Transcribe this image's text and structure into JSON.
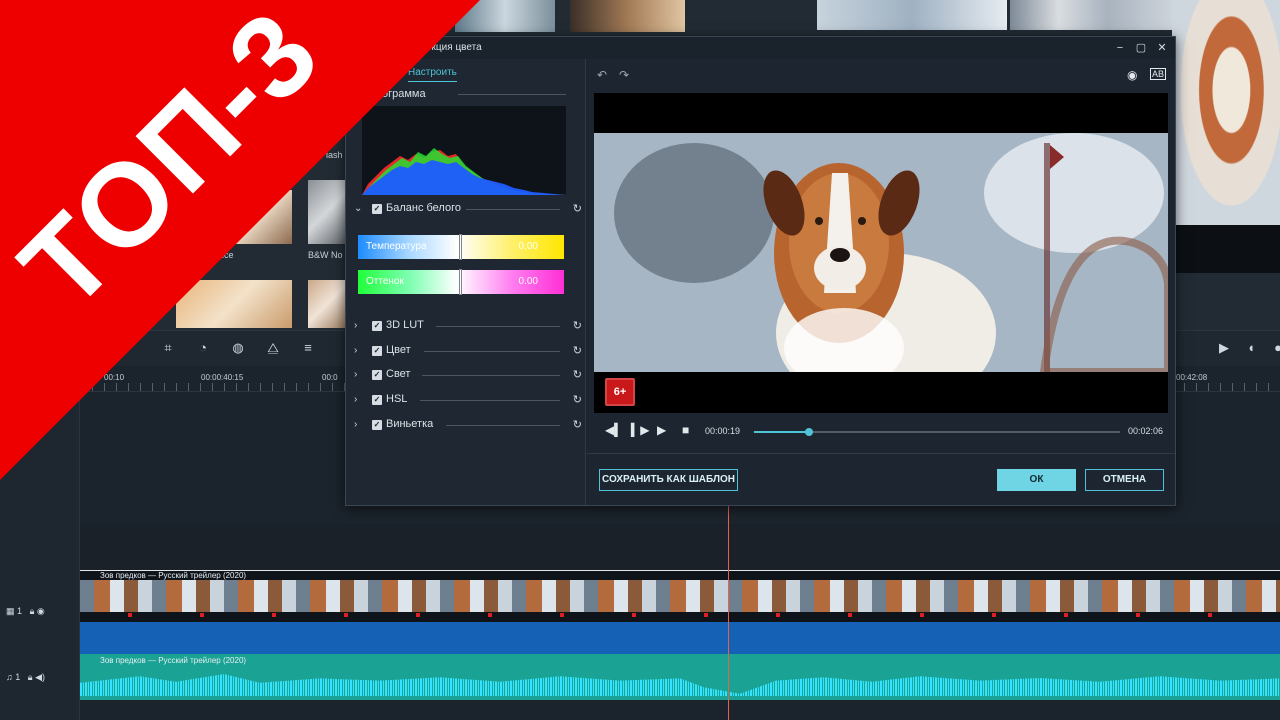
{
  "banner": {
    "text": "ТОП-3"
  },
  "library": {
    "labels": [
      "lash",
      "B&W No",
      "ice"
    ]
  },
  "timeline": {
    "ruler_labels": [
      "00:10",
      "00:00:40:15",
      "00:0",
      "00:42:08"
    ],
    "video_clip_title": "Зов предков — Русский трейлер (2020)",
    "audio_clip_title": "Зов предков — Русский трейлер (2020)",
    "video_track_num": "1",
    "audio_track_num": "1"
  },
  "dialog": {
    "title": "екция цвета",
    "tab_adjust": "Настроить",
    "histogram_title": "ограмма",
    "white_balance": "Баланс белого",
    "temperature_label": "Температура",
    "temperature_value": "0.00",
    "tint_label": "Оттенок",
    "tint_value": "0.00",
    "sections": [
      "3D LUT",
      "Цвет",
      "Свет",
      "HSL",
      "Виньетка"
    ],
    "age_badge": "6+",
    "current_time": "00:00:19",
    "total_time": "00:02:06",
    "progress_fraction": 0.15,
    "save_template": "СОХРАНИТЬ КАК ШАБЛОН",
    "ok": "ОК",
    "cancel": "ОТМЕНА"
  },
  "colors": {
    "accent": "#4fc3d7",
    "banner_red": "#ee0000",
    "ok_button": "#6fd5e5"
  }
}
